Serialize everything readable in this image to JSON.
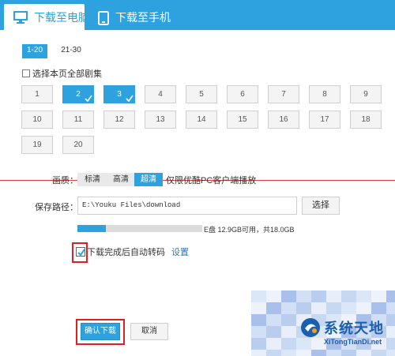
{
  "tabs": {
    "pc_label": "下载至电脑",
    "phone_label": "下载至手机"
  },
  "ranges": [
    "1-20",
    "21-30"
  ],
  "select_all_label": "选择本页全部剧集",
  "episodes": [
    "1",
    "2",
    "3",
    "4",
    "5",
    "6",
    "7",
    "8",
    "9",
    "10",
    "11",
    "12",
    "13",
    "14",
    "15",
    "16",
    "17",
    "18",
    "19",
    "20"
  ],
  "selected_episodes": [
    "2",
    "3"
  ],
  "quality": {
    "label": "画质：",
    "options": [
      "标清",
      "高清",
      "超清"
    ],
    "selected": "超清",
    "note": "仅限优酷PC客户端播放"
  },
  "save_path": {
    "label": "保存路径：",
    "value": "E:\\Youku Files\\download",
    "browse_label": "选择"
  },
  "disk": {
    "used_fraction": 0.23,
    "text": "E盘 12.9GB可用，共18.0GB"
  },
  "auto_transcode": {
    "checked": true,
    "label": "下载完成后自动转码",
    "settings_label": "设置"
  },
  "buttons": {
    "confirm": "确认下载",
    "cancel": "取消"
  },
  "watermark": {
    "title": "系统天地",
    "url": "XiTongTianDi.net"
  },
  "colors": {
    "accent": "#2ea2de",
    "highlight_box": "#e02020",
    "watermark": "#1b5fae"
  }
}
